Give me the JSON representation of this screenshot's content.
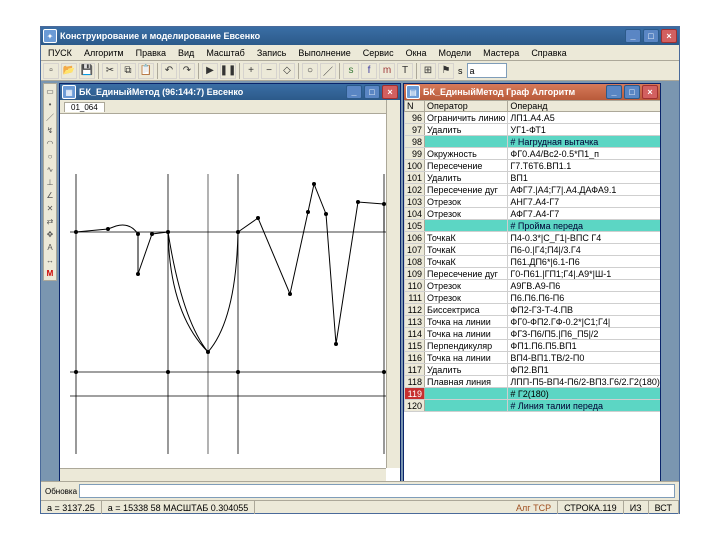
{
  "app": {
    "title": "Конструирование и моделирование  Евсенко"
  },
  "menus": [
    "ПУСК",
    "Алгоритм",
    "Правка",
    "Вид",
    "Масштаб",
    "Запись",
    "Выполнение",
    "Сервис",
    "Окна",
    "Модели",
    "Мастера",
    "Справка"
  ],
  "toolbar": {
    "icons": [
      "new",
      "open",
      "save",
      "sep",
      "cut",
      "copy",
      "paste",
      "sep",
      "undo",
      "redo",
      "sep",
      "run",
      "pause",
      "sep",
      "zoom-in",
      "zoom-out",
      "fit",
      "sep",
      "circle",
      "line",
      "sep",
      "s-icon",
      "f-icon",
      "m-icon",
      "t-icon",
      "sep",
      "snap-icon",
      "flag-icon"
    ],
    "s_combo_label": "s",
    "s_combo_value": "a"
  },
  "palette": [
    "select-tool",
    "point-tool",
    "line-tool",
    "polyline-tool",
    "arc-tool",
    "circle-tool",
    "spline-tool",
    "perp-tool",
    "angle-tool",
    "intersect-tool",
    "mirror-tool",
    "move-tool",
    "text-tool",
    "dim-tool",
    "M"
  ],
  "win_left": {
    "title": "БК_ЕдиныйМетод (96:144:7) Евсенко",
    "tab": "01_064"
  },
  "win_right": {
    "title": "БК_ЕдиныйМетод Граф Алгоритм",
    "cols": [
      "N",
      "Оператор",
      "Операнд"
    ],
    "rows": [
      {
        "n": "96",
        "op": "Ограничить линию",
        "opd": "ЛП1.A4.A5"
      },
      {
        "n": "97",
        "op": "Удалить",
        "opd": "УГ1-ФТ1"
      },
      {
        "n": "98",
        "op": "",
        "opd": "# Нагрудная вытачка",
        "section": true
      },
      {
        "n": "99",
        "op": "Окружность",
        "opd": "ФГ0.А4/Вс2-0.5*П1_п"
      },
      {
        "n": "100",
        "op": "Пересечение",
        "opd": "Г7.Т6Т6.ВП1.1"
      },
      {
        "n": "101",
        "op": "Удалить",
        "opd": "ВП1"
      },
      {
        "n": "102",
        "op": "Пересечение дуг",
        "opd": "АФГ7.|А4;Г7|.А4.ДАФА9.1"
      },
      {
        "n": "103",
        "op": "Отрезок",
        "opd": "АНГ7.А4-Г7"
      },
      {
        "n": "104",
        "op": "Отрезок",
        "opd": "АФГ7.А4-Г7"
      },
      {
        "n": "105",
        "op": "",
        "opd": "# Пройма переда",
        "section": true
      },
      {
        "n": "106",
        "op": "ТочкаК",
        "opd": "П4-0.3*|С_Г1|-ВПС Г4"
      },
      {
        "n": "107",
        "op": "ТочкаК",
        "opd": "П6-0.|Г4;П4|/3.Г4"
      },
      {
        "n": "108",
        "op": "ТочкаК",
        "opd": "П61.ДП6*|6.1-П6"
      },
      {
        "n": "109",
        "op": "Пересечение дуг",
        "opd": "Г0-П61.|ГП1;Г4|.А9*|Ш-1"
      },
      {
        "n": "110",
        "op": "Отрезок",
        "opd": "А9ГВ.А9-П6"
      },
      {
        "n": "111",
        "op": "Отрезок",
        "opd": "П6.П6.П6-П6"
      },
      {
        "n": "112",
        "op": "Биссектриса",
        "opd": "ФП2-Г3-Т-4.ПВ"
      },
      {
        "n": "113",
        "op": "Точка на линии",
        "opd": "ФГ0-ФП2.ГФ-0.2*|C1;Г4|"
      },
      {
        "n": "114",
        "op": "Точка на линии",
        "opd": "ФГЗ-П6/П5.|П6_П5|/2"
      },
      {
        "n": "115",
        "op": "Перпендикуляр",
        "opd": "ФП1.П6.П5.ВП1"
      },
      {
        "n": "116",
        "op": "Точка на линии",
        "opd": "ВП4-ВП1.ТВ/2-П0"
      },
      {
        "n": "117",
        "op": "Удалить",
        "opd": "ФП2.ВП1"
      },
      {
        "n": "118",
        "op": "Плавная линия",
        "opd": "ЛПП-П5-ВП4-П6/2-ВП3.Г6/2.Г2(180)"
      },
      {
        "n": "119",
        "op": "",
        "opd": "# Г2(180)",
        "hl": true
      },
      {
        "n": "120",
        "op": "",
        "opd": "# Линия талии переда",
        "section": true
      }
    ]
  },
  "cmd": {
    "label": "Обновка"
  },
  "status": {
    "coord_a": "a = 3137.25",
    "coord_a2": "а = 15338 58 МАСШТАБ 0.304055",
    "alg": "Алг ТСР",
    "line": "СТРОКА.119",
    "mod": "ИЗ",
    "ins": "ВСТ"
  }
}
